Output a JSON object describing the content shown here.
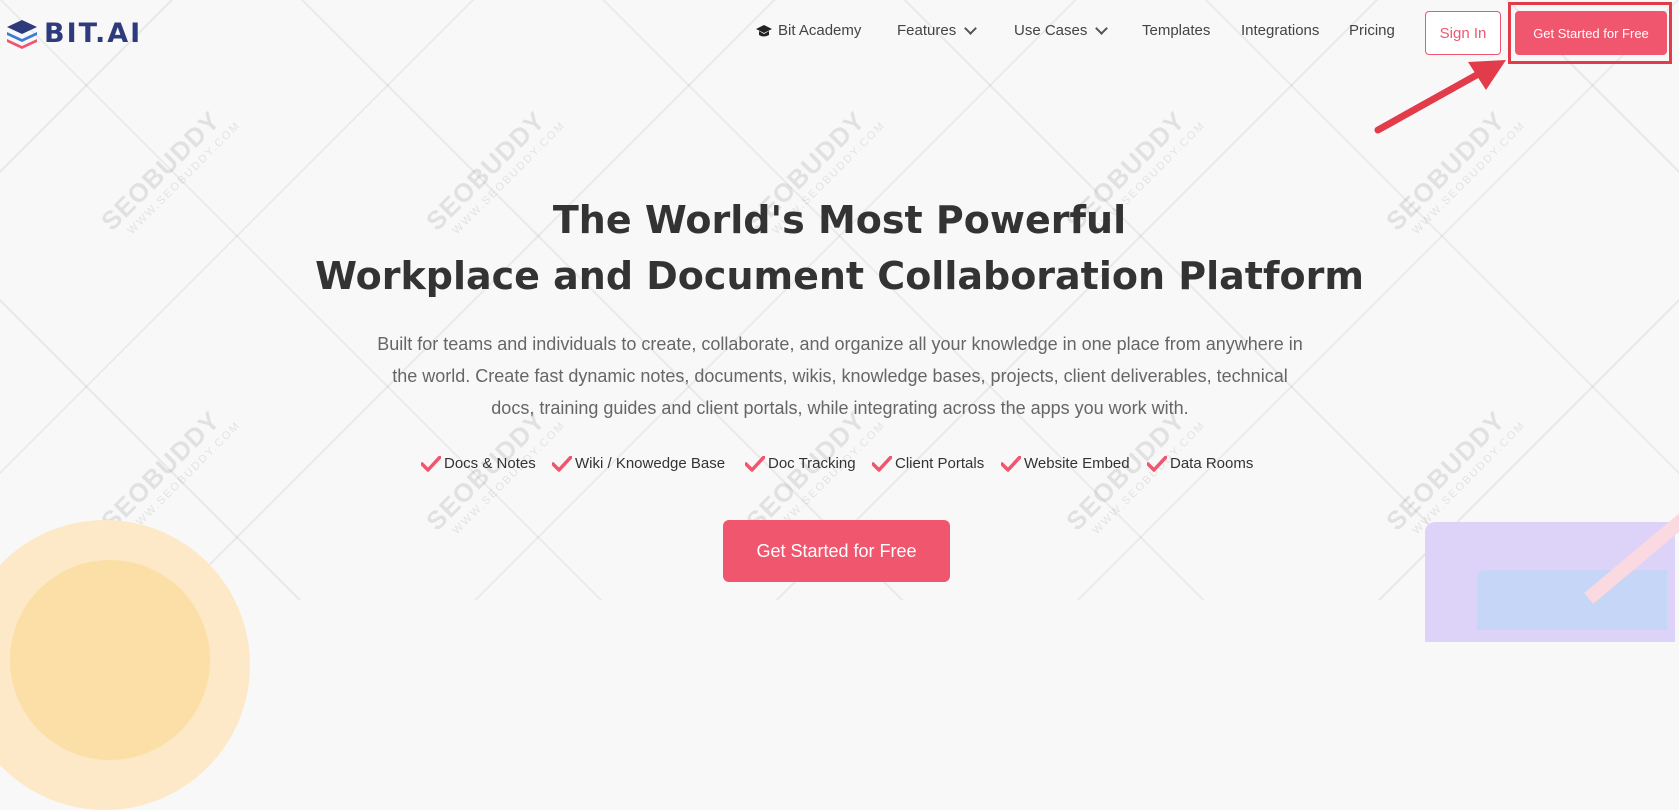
{
  "brand": {
    "logo_text": "BIT.AI",
    "primary_color": "#f0566e",
    "logo_color": "#2d3a7c"
  },
  "nav": {
    "items": [
      {
        "label": "Bit Academy",
        "icon": "graduation-cap-icon"
      },
      {
        "label": "Features",
        "icon": "chevron-down-icon"
      },
      {
        "label": "Use Cases",
        "icon": "chevron-down-icon"
      },
      {
        "label": "Templates"
      },
      {
        "label": "Integrations"
      },
      {
        "label": "Pricing"
      }
    ],
    "sign_in_label": "Sign In",
    "cta_label": "Get Started for Free"
  },
  "hero": {
    "title_line1": "The World's Most Powerful",
    "title_line2": "Workplace and Document Collaboration Platform",
    "description": "Built for teams and individuals to create, collaborate, and organize all your knowledge in one place from anywhere in the world. Create fast dynamic notes, documents, wikis, knowledge bases, projects, client deliverables, technical docs, training guides and client portals, while integrating across the apps you work with.",
    "features": [
      "Docs & Notes",
      "Wiki / Knowedge Base",
      "Doc Tracking",
      "Client Portals",
      "Website Embed",
      "Data Rooms"
    ],
    "cta_label": "Get Started for Free"
  },
  "watermark": {
    "main": "SEOBUDDY",
    "sub": "WWW.SEOBUDDY.COM"
  },
  "annotation": {
    "highlight_color": "#e23b4a"
  }
}
